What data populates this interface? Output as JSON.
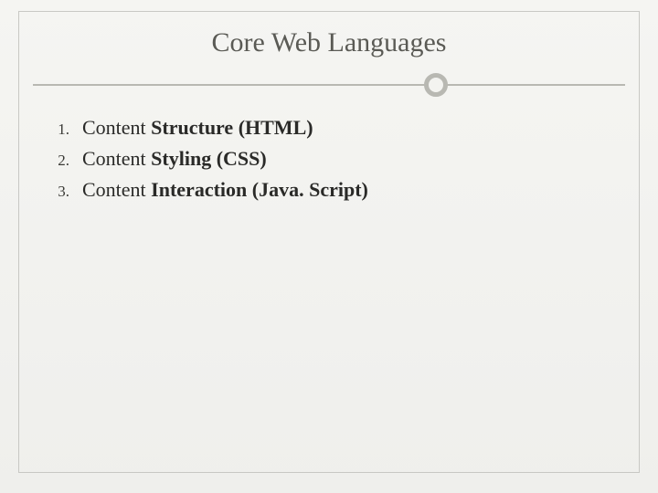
{
  "slide": {
    "title": "Core Web Languages",
    "items": [
      {
        "prefix": "Content ",
        "bold": "Structure (HTML)"
      },
      {
        "prefix": "Content ",
        "bold": "Styling (CSS)"
      },
      {
        "prefix": "Content ",
        "bold": "Interaction (Java. Script)"
      }
    ]
  }
}
